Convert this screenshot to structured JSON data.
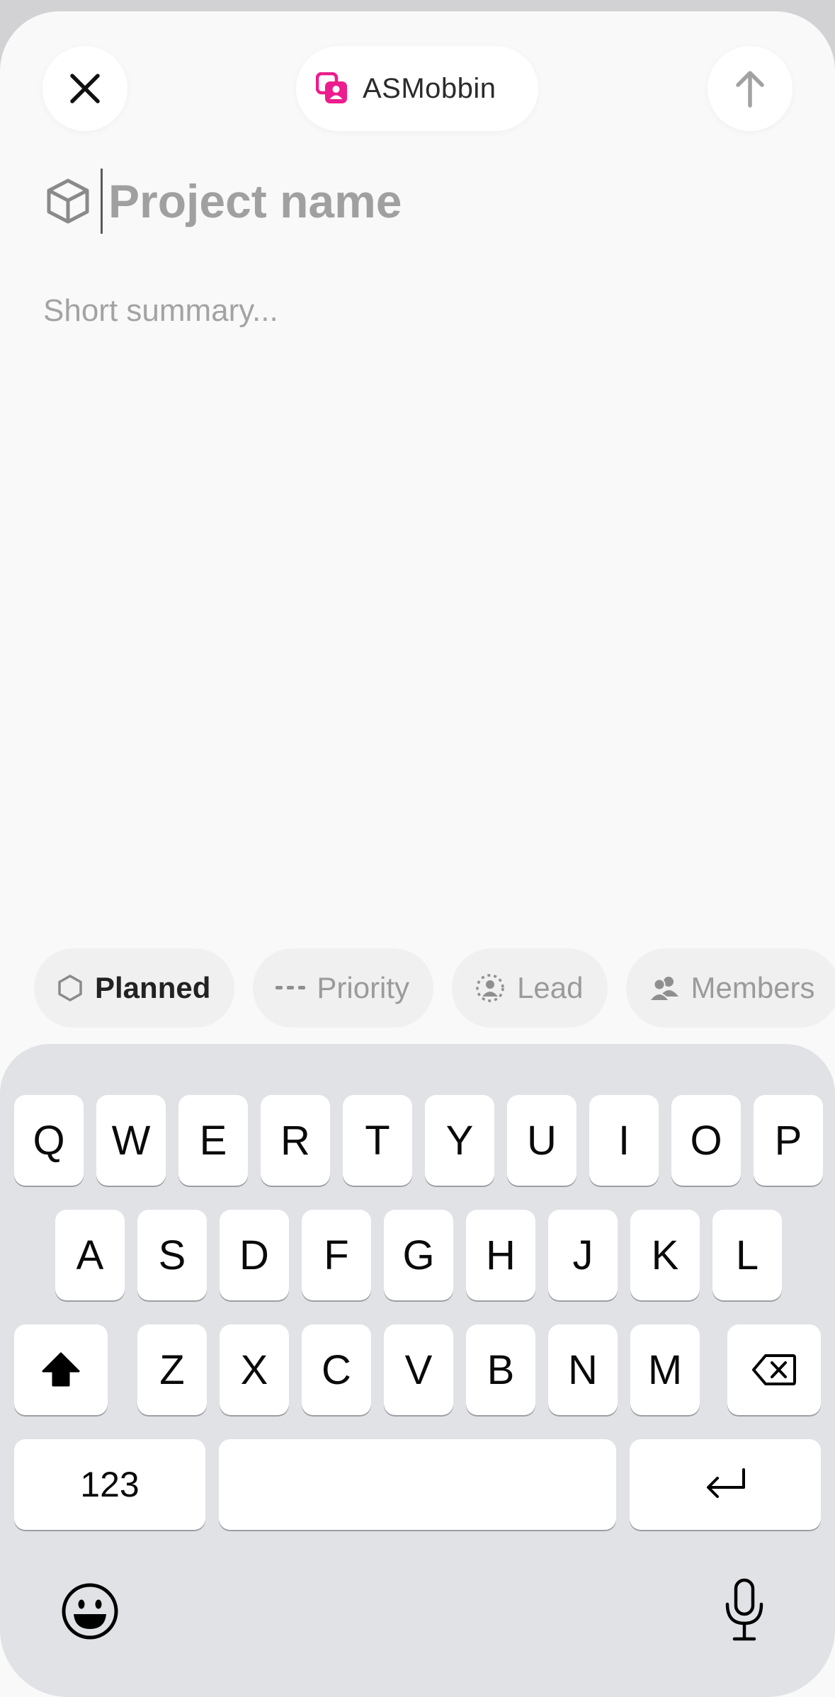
{
  "header": {
    "close_icon": "close-icon",
    "team_name": "ASMobbin",
    "team_icon": "team-avatar-icon",
    "team_color": "#ec1d8c",
    "submit_icon": "arrow-up-icon"
  },
  "project": {
    "icon": "cube-icon",
    "name_placeholder": "Project name",
    "summary_placeholder": "Short summary..."
  },
  "properties": [
    {
      "icon": "hexagon-icon",
      "label": "Planned"
    },
    {
      "icon": "priority-dashes-icon",
      "label": "Priority"
    },
    {
      "icon": "lead-person-icon",
      "label": "Lead"
    },
    {
      "icon": "members-icon",
      "label": "Members"
    }
  ],
  "keyboard": {
    "row1": [
      "Q",
      "W",
      "E",
      "R",
      "T",
      "Y",
      "U",
      "I",
      "O",
      "P"
    ],
    "row2": [
      "A",
      "S",
      "D",
      "F",
      "G",
      "H",
      "J",
      "K",
      "L"
    ],
    "row3": [
      "Z",
      "X",
      "C",
      "V",
      "B",
      "N",
      "M"
    ],
    "numbers_label": "123",
    "shift_icon": "shift-icon",
    "delete_icon": "delete-icon",
    "return_icon": "return-icon",
    "emoji_icon": "emoji-icon",
    "mic_icon": "microphone-icon"
  }
}
